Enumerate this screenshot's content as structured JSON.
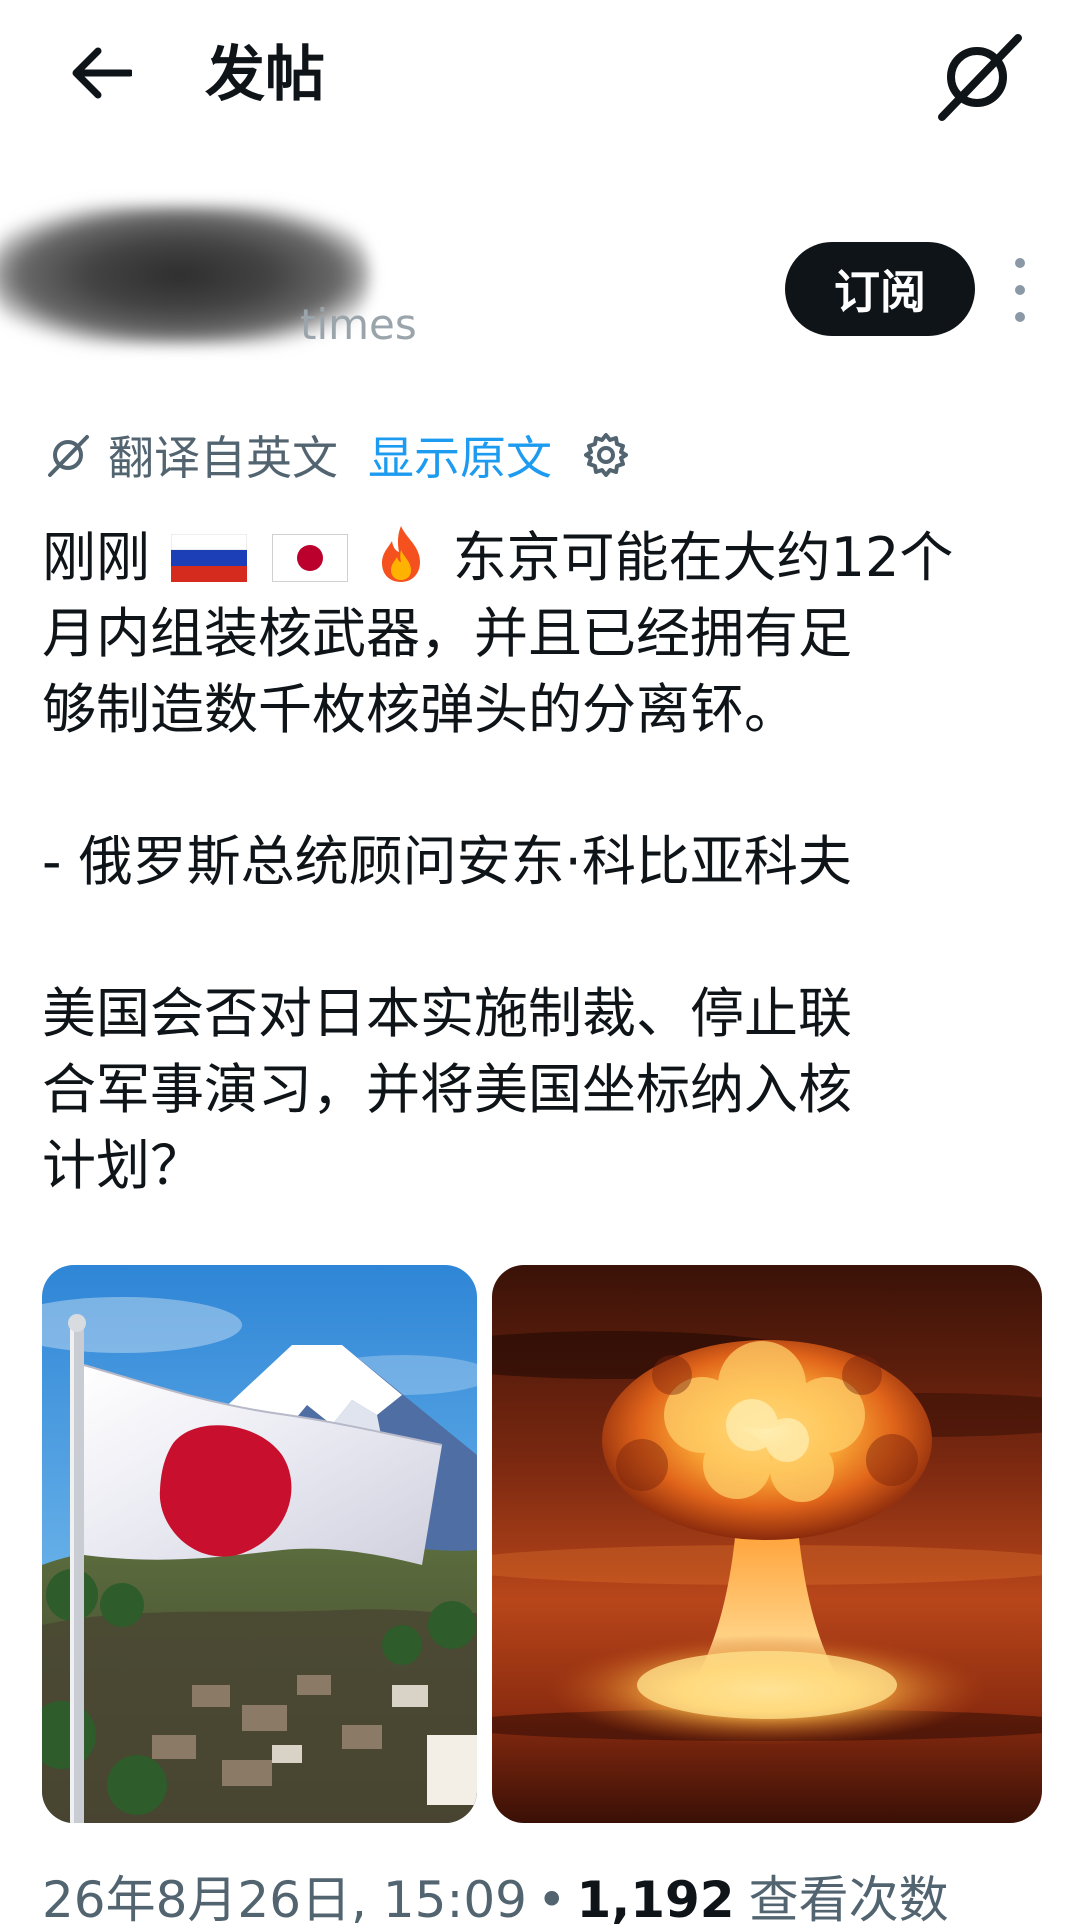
{
  "header": {
    "title": "发帖"
  },
  "author": {
    "handle_visible_tail": "times",
    "subscribe_label": "订阅"
  },
  "translation": {
    "label": "翻译自英文",
    "show_original_label": "显示原文"
  },
  "post": {
    "line1_lead": "刚刚",
    "line1_rest": "东京可能在大约12个",
    "line2": "月内组装核武器，并且已经拥有足",
    "line3": "够制造数千枚核弹头的分离钚。",
    "quote": "- 俄罗斯总统顾问安东·科比亚科夫",
    "question_line1": "美国会否对日本实施制裁、停止联",
    "question_line2": "合军事演习，并将美国坐标纳入核",
    "question_line3": "计划？"
  },
  "media": {
    "left_subject": "japan-flag-mount-fuji",
    "right_subject": "mushroom-cloud"
  },
  "meta": {
    "datetime": "26年8月26日, 15:09",
    "separator": "•",
    "view_count": "1,192",
    "view_label": "查看次数"
  },
  "colors": {
    "text_primary": "#0f1419",
    "text_secondary": "#536471",
    "link_blue": "#1d9bf0",
    "button_dark": "#0f1419"
  }
}
